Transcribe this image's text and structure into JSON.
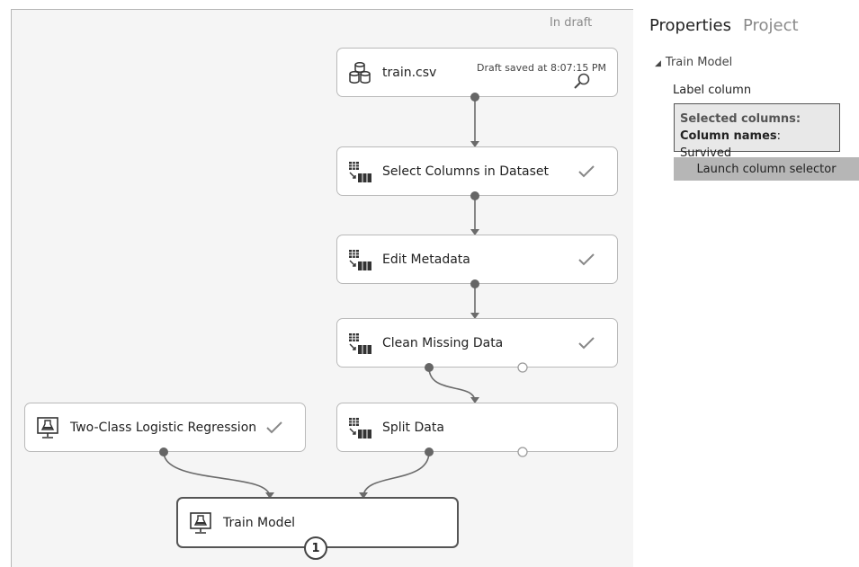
{
  "canvas": {
    "status": "In draft"
  },
  "modules": {
    "train_csv": {
      "label": "train.csv",
      "meta": "Draft saved at 8:07:15 PM"
    },
    "select_columns": {
      "label": "Select Columns in Dataset"
    },
    "edit_metadata": {
      "label": "Edit Metadata"
    },
    "clean_missing": {
      "label": "Clean Missing Data"
    },
    "split_data": {
      "label": "Split Data"
    },
    "logistic_regression": {
      "label": "Two-Class Logistic Regression"
    },
    "train_model": {
      "label": "Train Model",
      "badge": "1"
    }
  },
  "panel": {
    "tabs": [
      "Properties",
      "Project"
    ],
    "section_title": "Train Model",
    "field_label": "Label column",
    "selected_columns_header": "Selected columns:",
    "column_names_key": "Column names",
    "column_names_value": ": Survived",
    "launch_button": "Launch column selector"
  },
  "icons": {
    "dataset": "database-icon",
    "module": "table-transform-icon",
    "model": "flask-monitor-icon",
    "done": "checkmark-icon",
    "visualize": "magnifier-icon"
  },
  "colors": {
    "canvas_bg": "#f5f5f5",
    "wire": "#666666",
    "selected_border": "#555555",
    "button_bg": "#b6b6b6"
  }
}
